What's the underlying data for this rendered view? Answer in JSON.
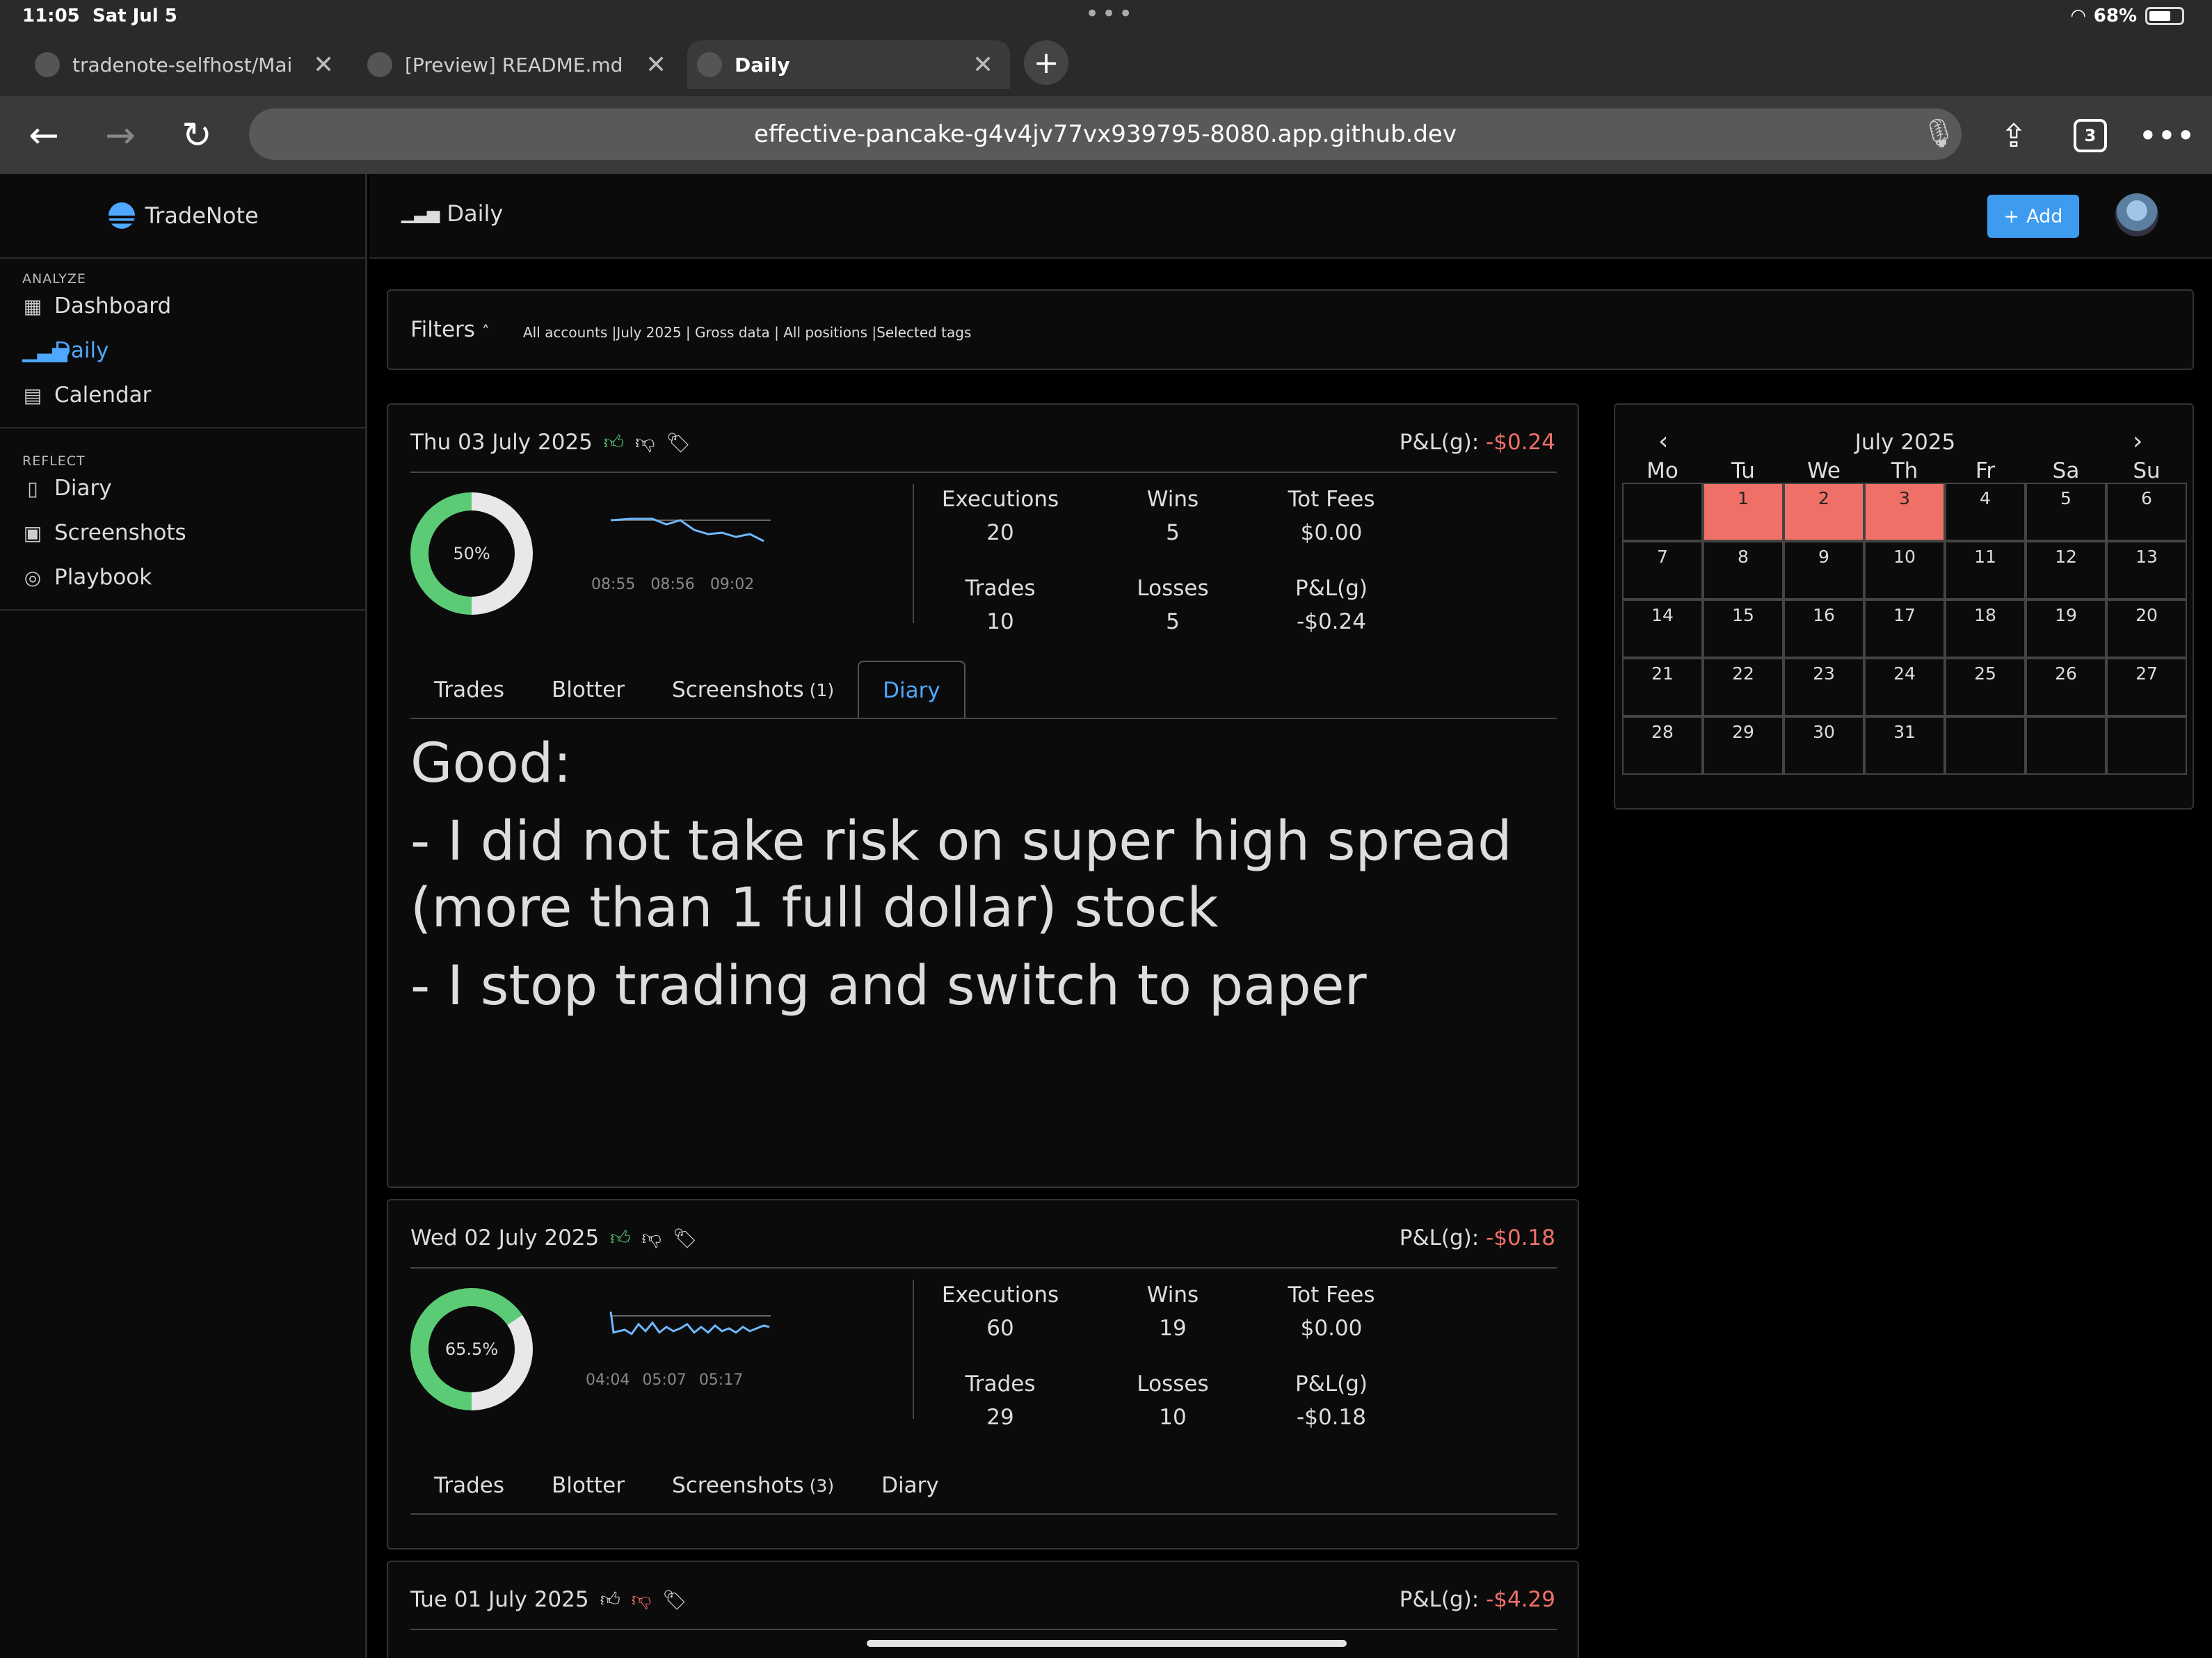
{
  "status": {
    "time": "11:05",
    "date": "Sat Jul 5",
    "battery": "68%"
  },
  "browser": {
    "tabs": [
      {
        "title": "tradenote-selfhost/Mai",
        "active": false
      },
      {
        "title": "[Preview] README.md",
        "active": false
      },
      {
        "title": "Daily",
        "active": true
      }
    ],
    "url": "effective-pancake-g4v4jv77vx939795-8080.app.github.dev",
    "tab_count": "3"
  },
  "app": {
    "brand": "TradeNote",
    "page_title": "Daily",
    "add_label": "Add",
    "sidebar": {
      "analyze_header": "ANALYZE",
      "analyze": [
        {
          "label": "Dashboard",
          "icon": "grid-icon"
        },
        {
          "label": "Daily",
          "icon": "bar-chart-icon"
        },
        {
          "label": "Calendar",
          "icon": "calendar-icon"
        }
      ],
      "reflect_header": "REFLECT",
      "reflect": [
        {
          "label": "Diary",
          "icon": "book-icon"
        },
        {
          "label": "Screenshots",
          "icon": "image-icon"
        },
        {
          "label": "Playbook",
          "icon": "compass-icon"
        }
      ]
    },
    "filters": {
      "label": "Filters",
      "summary": "All accounts |July 2025 | Gross data | All positions |Selected tags"
    }
  },
  "days": [
    {
      "date": "Thu 03 July 2025",
      "pnl_label": "P&L(g):",
      "pnl": "-$0.24",
      "win_rate": "50%",
      "win_fraction": 0.5,
      "spark_labels": [
        "08:55",
        "08:56",
        "09:02"
      ],
      "stats": {
        "executions_label": "Executions",
        "executions": "20",
        "wins_label": "Wins",
        "wins": "5",
        "fees_label": "Tot Fees",
        "fees": "$0.00",
        "trades_label": "Trades",
        "trades": "10",
        "losses_label": "Losses",
        "losses": "5",
        "pnlg_label": "P&L(g)",
        "pnlg": "-$0.24"
      },
      "tabs": {
        "trades": "Trades",
        "blotter": "Blotter",
        "screenshots": "Screenshots",
        "screenshots_count": "(1)",
        "diary": "Diary"
      },
      "diary": [
        "Good:",
        "- I did not take risk on super high spread (more than 1 full dollar) stock",
        "- I stop trading and switch to paper"
      ]
    },
    {
      "date": "Wed 02 July 2025",
      "pnl_label": "P&L(g):",
      "pnl": "-$0.18",
      "win_rate": "65.5%",
      "win_fraction": 0.655,
      "spark_labels": [
        "04:04",
        "05:07",
        "05:17"
      ],
      "stats": {
        "executions_label": "Executions",
        "executions": "60",
        "wins_label": "Wins",
        "wins": "19",
        "fees_label": "Tot Fees",
        "fees": "$0.00",
        "trades_label": "Trades",
        "trades": "29",
        "losses_label": "Losses",
        "losses": "10",
        "pnlg_label": "P&L(g)",
        "pnlg": "-$0.18"
      },
      "tabs": {
        "trades": "Trades",
        "blotter": "Blotter",
        "screenshots": "Screenshots",
        "screenshots_count": "(3)",
        "diary": "Diary"
      }
    },
    {
      "date": "Tue 01 July 2025",
      "pnl_label": "P&L(g):",
      "pnl": "-$4.29"
    }
  ],
  "calendar": {
    "month": "July 2025",
    "weekdays": [
      "Mo",
      "Tu",
      "We",
      "Th",
      "Fr",
      "Sa",
      "Su"
    ],
    "cells": [
      "",
      "1",
      "2",
      "3",
      "4",
      "5",
      "6",
      "7",
      "8",
      "9",
      "10",
      "11",
      "12",
      "13",
      "14",
      "15",
      "16",
      "17",
      "18",
      "19",
      "20",
      "21",
      "22",
      "23",
      "24",
      "25",
      "26",
      "27",
      "28",
      "29",
      "30",
      "31",
      "",
      "",
      ""
    ],
    "loss_days": [
      "1",
      "2",
      "3"
    ],
    "loss_color": "#ef7066"
  },
  "colors": {
    "accent": "#3d9cf0",
    "loss": "#f0706a",
    "win": "#5ccb76"
  }
}
